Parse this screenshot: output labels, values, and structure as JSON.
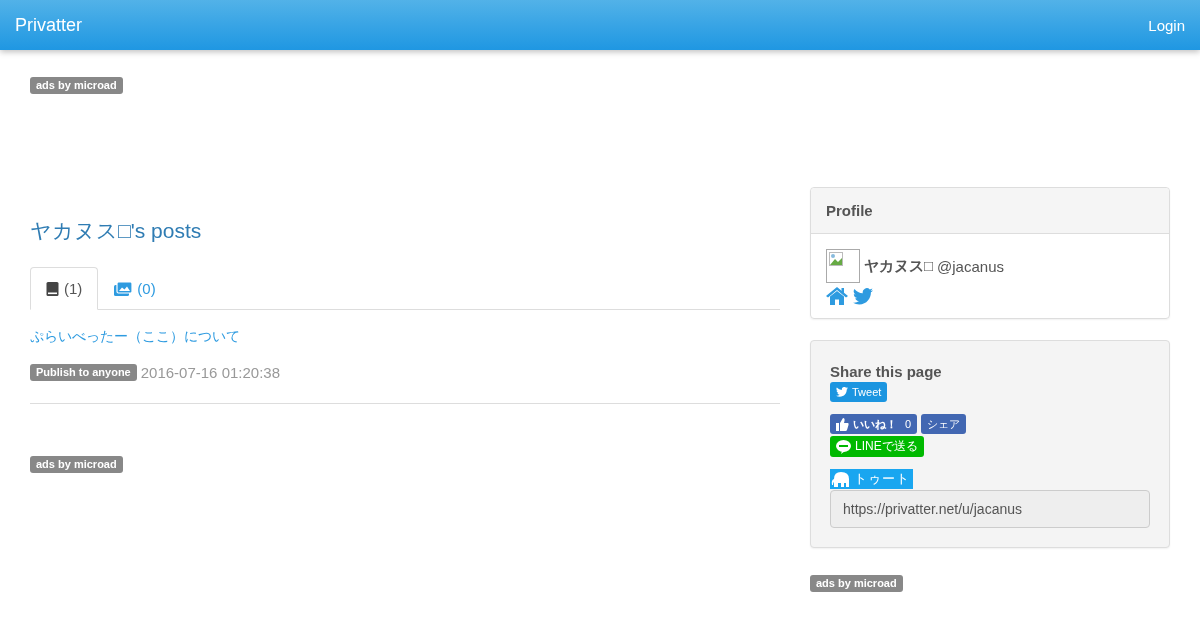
{
  "navbar": {
    "brand": "Privatter",
    "login": "Login"
  },
  "top_ad": {
    "label": "ads by microad"
  },
  "main": {
    "title": "ヤカヌス□'s posts",
    "tabs": [
      {
        "kind": "book",
        "label": "(1)",
        "selected": true
      },
      {
        "kind": "image",
        "label": "(0)",
        "selected": false
      }
    ],
    "posts": [
      {
        "title": "ぷらいべったー（ここ）について",
        "visibility": "Publish to anyone",
        "date": "2016-07-16 01:20:38"
      }
    ],
    "ad": {
      "label": "ads by microad"
    }
  },
  "sidebar": {
    "profile": {
      "heading": "Profile",
      "name": "ヤカヌス□",
      "handle": "@jacanus",
      "links": [
        {
          "kind": "home"
        },
        {
          "kind": "twitter"
        }
      ]
    },
    "share": {
      "heading": "Share this page",
      "buttons": [
        {
          "kind": "tweet",
          "label": "Tweet"
        },
        {
          "kind": "like",
          "label": "いいね！",
          "count": "0"
        },
        {
          "kind": "fbshare",
          "label": "シェア"
        },
        {
          "kind": "line",
          "label": "LINEで送る"
        },
        {
          "kind": "toot",
          "label": "トゥート"
        }
      ],
      "url": "https://privatter.net/u/jacanus"
    },
    "ad": {
      "label": "ads by microad"
    }
  }
}
